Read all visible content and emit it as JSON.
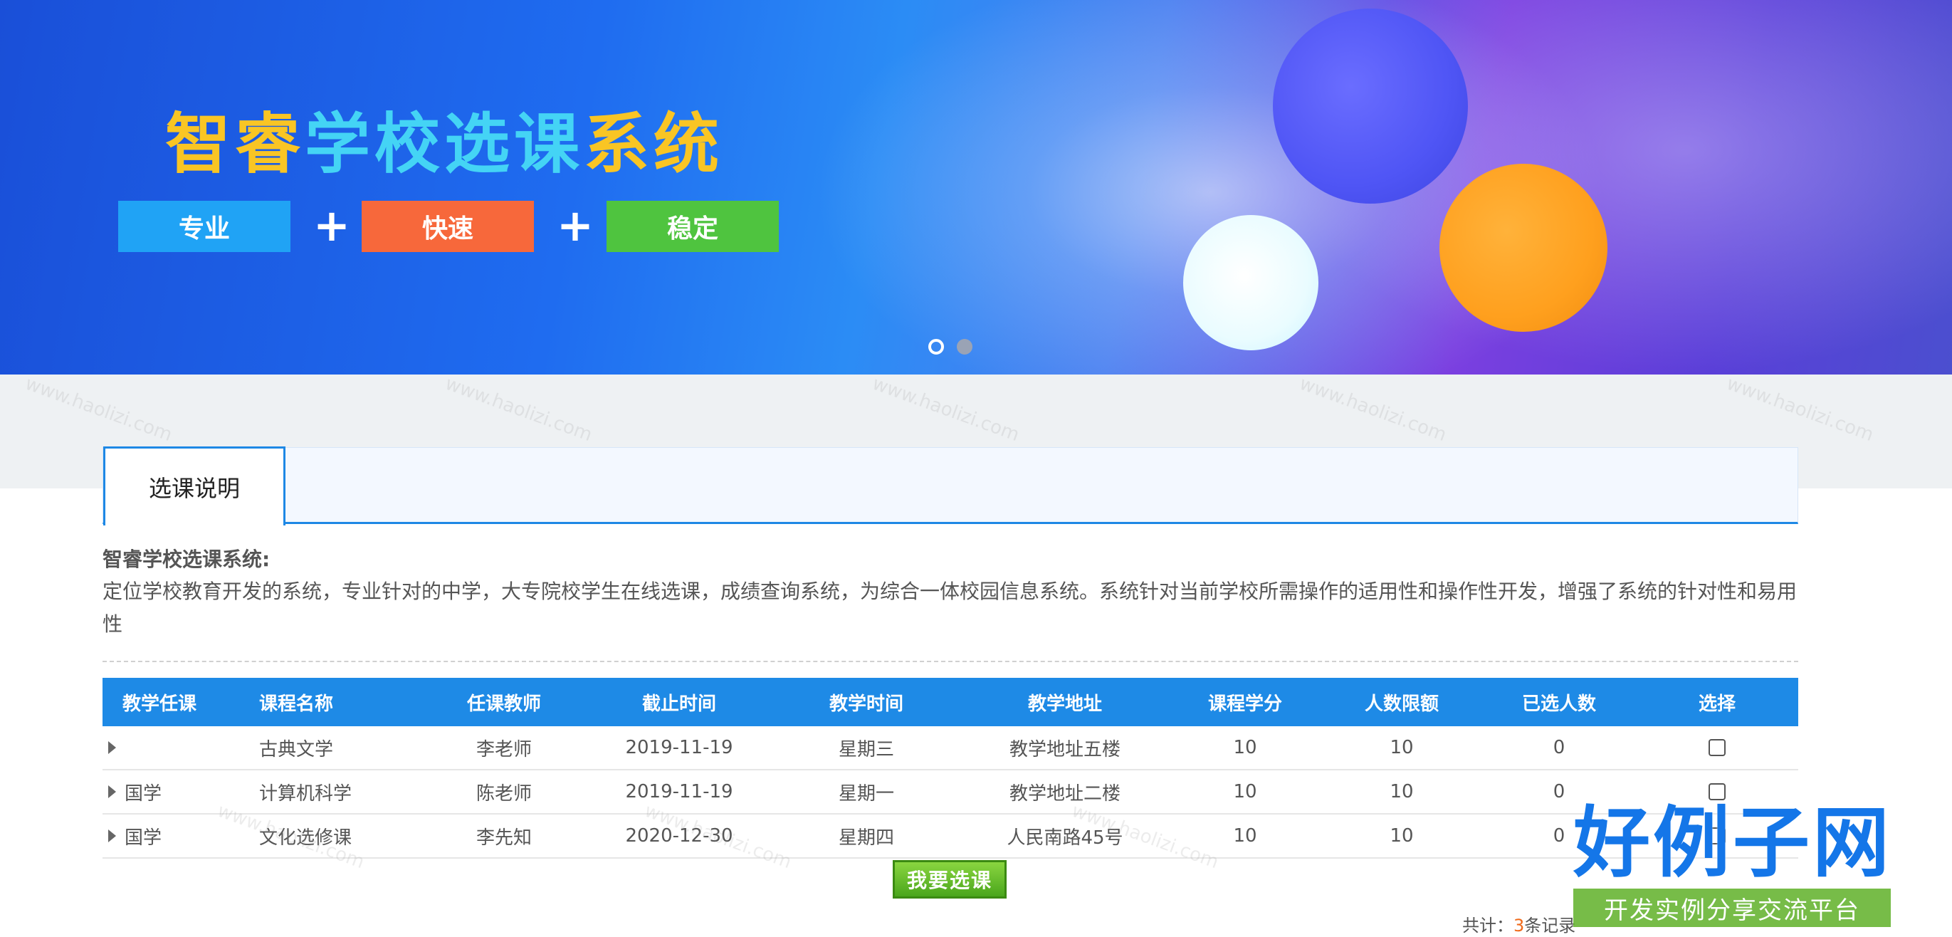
{
  "banner": {
    "title_part1": "智睿",
    "title_part2": "学校选课",
    "title_part3": "系统",
    "tags": [
      "专业",
      "快速",
      "稳定"
    ],
    "plus": "+",
    "carousel_index": 1,
    "carousel_count": 2,
    "colors": {
      "tag1": "#20a3f5",
      "tag2": "#f7683b",
      "tag3": "#4fc43f"
    }
  },
  "tabs": [
    {
      "label": "选课说明",
      "active": true
    }
  ],
  "description": {
    "title": "智睿学校选课系统:",
    "body": "定位学校教育开发的系统，专业针对的中学，大专院校学生在线选课，成绩查询系统，为综合一体校园信息系统。系统针对当前学校所需操作的适用性和操作性开发，增强了系统的针对性和易用性"
  },
  "table": {
    "headers": [
      "教学任课",
      "课程名称",
      "任课教师",
      "截止时间",
      "教学时间",
      "教学地址",
      "课程学分",
      "人数限额",
      "已选人数",
      "选择"
    ],
    "rows": [
      {
        "category": "",
        "course": "古典文学",
        "teacher": "李老师",
        "deadline": "2019-11-19",
        "time": "星期三",
        "address": "教学地址五楼",
        "credits": "10",
        "limit": "10",
        "selected": "0",
        "checked": false
      },
      {
        "category": "国学",
        "course": "计算机科学",
        "teacher": "陈老师",
        "deadline": "2019-11-19",
        "time": "星期一",
        "address": "教学地址二楼",
        "credits": "10",
        "limit": "10",
        "selected": "0",
        "checked": false
      },
      {
        "category": "国学",
        "course": "文化选修课",
        "teacher": "李先知",
        "deadline": "2020-12-30",
        "time": "星期四",
        "address": "人民南路45号",
        "credits": "10",
        "limit": "10",
        "selected": "0",
        "checked": false
      }
    ]
  },
  "submit_label": "我要选课",
  "total": {
    "prefix": "共计：",
    "count": "3",
    "suffix": "条记录"
  },
  "watermark": {
    "logo_main": "好例子网",
    "logo_sub": "开发实例分享交流平台",
    "repeat_text": "www.haolizi.com"
  }
}
